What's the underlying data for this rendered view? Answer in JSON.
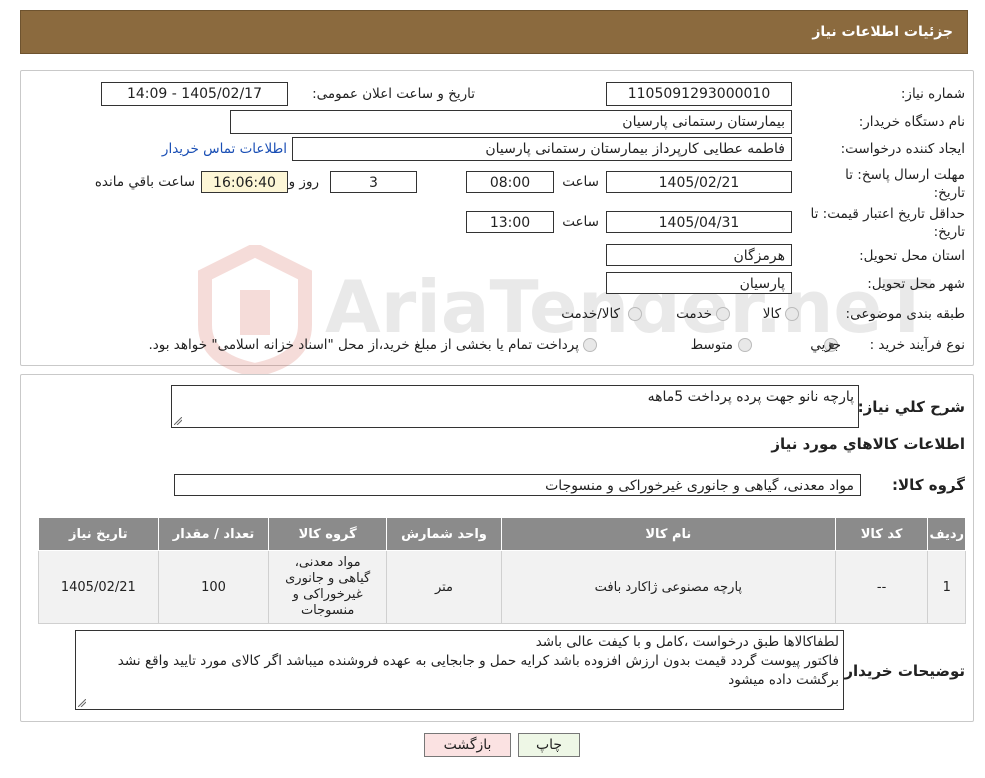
{
  "header": {
    "title": "جزئیات اطلاعات نیاز"
  },
  "form": {
    "need_number_label": "شماره نیاز:",
    "need_number": "1105091293000010",
    "announce_label": "تاریخ و ساعت اعلان عمومی:",
    "announce_value": "1405/02/17 - 14:09",
    "buyer_org_label": "نام دستگاه خریدار:",
    "buyer_org": "بیمارستان رستمانی پارسیان",
    "creator_label": "ایجاد کننده درخواست:",
    "creator": "فاطمه عطایی کارپرداز بیمارستان رستمانی پارسیان",
    "contact_link": "اطلاعات تماس خریدار",
    "deadline_label_1": "مهلت ارسال پاسخ: تا",
    "deadline_label_2": "تاریخ:",
    "deadline_date": "1405/02/21",
    "time_label": "ساعت",
    "deadline_time": "08:00",
    "days_value": "3",
    "days_label": "روز و",
    "remaining_time": "16:06:40",
    "remaining_label": "ساعت باقي مانده",
    "validity_label_1": "حداقل تاریخ اعتبار قیمت: تا",
    "validity_label_2": "تاریخ:",
    "validity_date": "1405/04/31",
    "validity_time": "13:00",
    "province_label": "استان محل تحویل:",
    "province": "هرمزگان",
    "city_label": "شهر محل تحویل:",
    "city": "پارسیان",
    "category_label": "طبقه بندی موضوعی:",
    "category_options": [
      "کالا",
      "خدمت",
      "کالا/خدمت"
    ],
    "process_label": "نوع فرآیند خرید :",
    "process_options": [
      "جزیي",
      "متوسط"
    ],
    "process_note": "پرداخت تمام یا بخشی از مبلغ خرید،از محل \"اسناد خزانه اسلامی\" خواهد بود."
  },
  "summary": {
    "desc_label": "شرح کلي نياز:",
    "desc_value": "پارچه نانو جهت پرده پرداخت 5ماهه",
    "goods_info_title": "اطلاعات کالاهاي مورد نياز",
    "goods_group_label": "گروه کالا:",
    "goods_group_value": "مواد معدنی، گیاهی و جانوری غیرخوراکی و منسوجات"
  },
  "table": {
    "headers": [
      "رديف",
      "کد کالا",
      "نام کالا",
      "واحد شمارش",
      "گروه کالا",
      "تعداد / مقدار",
      "تاريخ نياز"
    ],
    "rows": [
      [
        "1",
        "--",
        "پارچه مصنوعی ژاکارد بافت",
        "متر",
        "مواد معدنی، گیاهی و جانوری غیرخوراکی و منسوجات",
        "100",
        "1405/02/21"
      ]
    ]
  },
  "notes": {
    "label": "توضيحات خريدار:",
    "line1": "لطفاکالاها طبق درخواست ،کامل و با کیفت عالی باشد",
    "line2": "فاکتور پیوست گردد قیمت بدون ارزش افزوده باشد کرایه حمل و جابجایی به عهده فروشنده میباشد اگر کالای مورد تایید واقع نشد برگشت داده میشود"
  },
  "buttons": {
    "print": "چاپ",
    "back": "بازگشت"
  },
  "watermark": {
    "text": "AriaTender.neT"
  },
  "colors": {
    "header_bg": "#8b6a3e",
    "link": "#1a4fb5",
    "table_header": "#8b8b8b"
  }
}
